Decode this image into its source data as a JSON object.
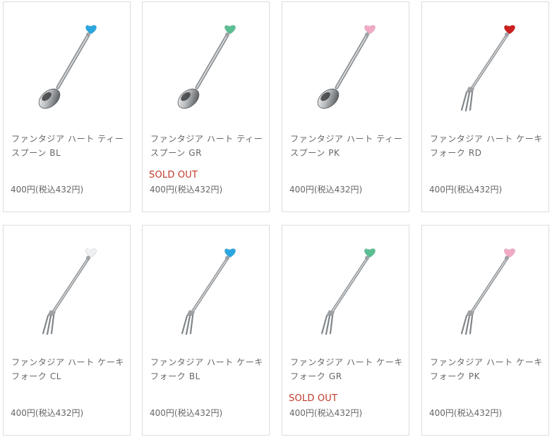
{
  "products": [
    {
      "name": "ファンタジア ハート ティースプーン BL",
      "price": "400円(税込432円)",
      "status": "",
      "item_type": "spoon",
      "heart_color": "#2aa7e0"
    },
    {
      "name": "ファンタジア ハート ティースプーン GR",
      "price": "400円(税込432円)",
      "status": "SOLD OUT",
      "item_type": "spoon",
      "heart_color": "#5bbf94"
    },
    {
      "name": "ファンタジア ハート ティースプーン PK",
      "price": "400円(税込432円)",
      "status": "",
      "item_type": "spoon",
      "heart_color": "#f2a9c6"
    },
    {
      "name": "ファンタジア ハート ケーキフォーク RD",
      "price": "400円(税込432円)",
      "status": "",
      "item_type": "fork",
      "heart_color": "#cc1f1f"
    },
    {
      "name": "ファンタジア ハート ケーキフォーク CL",
      "price": "400円(税込432円)",
      "status": "",
      "item_type": "fork",
      "heart_color": "#eef1f3"
    },
    {
      "name": "ファンタジア ハート ケーキフォーク BL",
      "price": "400円(税込432円)",
      "status": "",
      "item_type": "fork",
      "heart_color": "#2aa7e0"
    },
    {
      "name": "ファンタジア ハート ケーキフォーク GR",
      "price": "400円(税込432円)",
      "status": "SOLD OUT",
      "item_type": "fork",
      "heart_color": "#5bbf94"
    },
    {
      "name": "ファンタジア ハート ケーキフォーク PK",
      "price": "400円(税込432円)",
      "status": "",
      "item_type": "fork",
      "heart_color": "#f2a9c6"
    }
  ]
}
